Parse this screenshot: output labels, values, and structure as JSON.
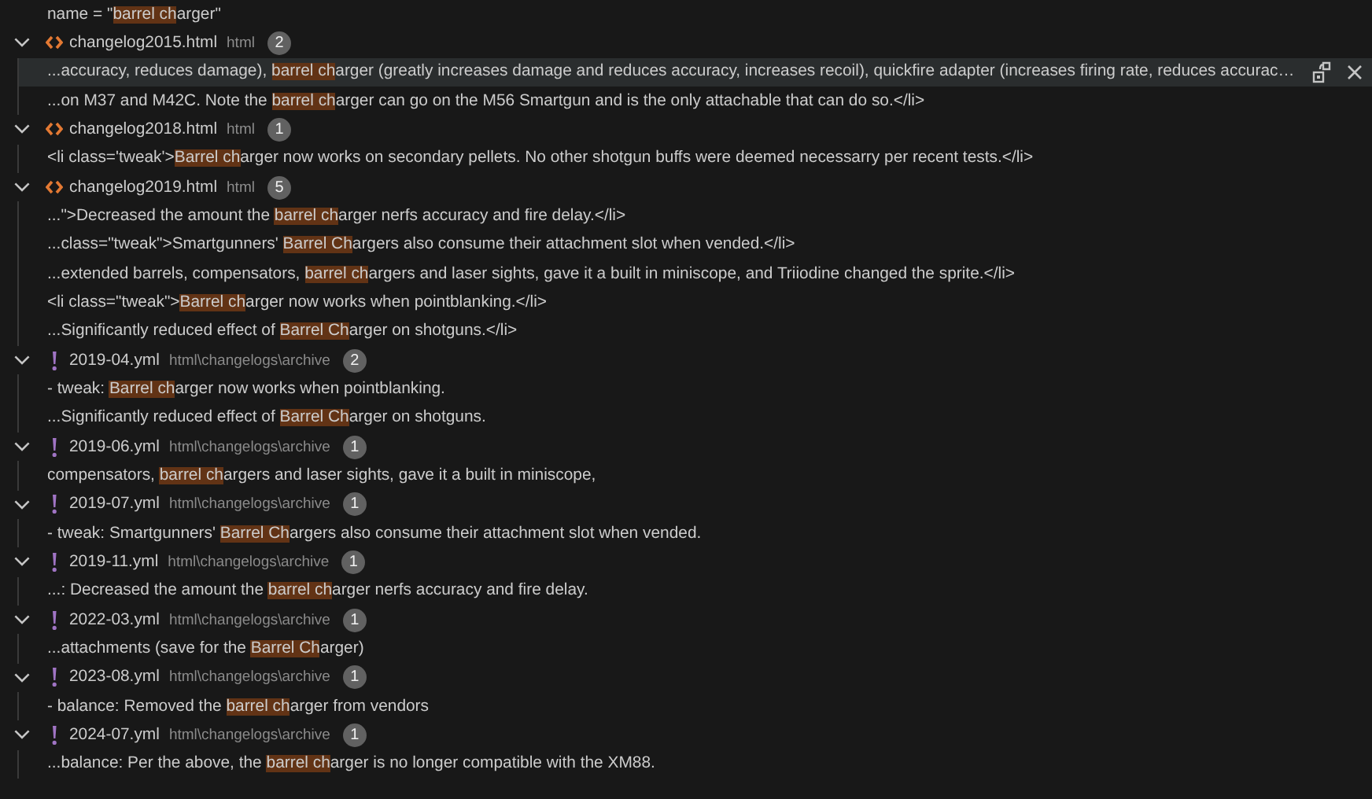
{
  "top_line": {
    "before": "name = \"",
    "match": "barrel ch",
    "after": "arger\""
  },
  "files": [
    {
      "name": "changelog2015.html",
      "kind": "markup",
      "detail": "html",
      "count": "2",
      "expanded": true,
      "matches": [
        {
          "before": "...accuracy, reduces damage), ",
          "match": "barrel ch",
          "after": "arger (greatly increases damage and reduces accuracy, increases recoil), quickfire adapter (increases firing rate, reduces accurac…",
          "selected": true
        },
        {
          "before": "...on M37 and M42C. Note the ",
          "match": "barrel ch",
          "after": "arger can go on the M56 Smartgun and is the only attachable that can do so.</li>",
          "selected": false
        }
      ]
    },
    {
      "name": "changelog2018.html",
      "kind": "markup",
      "detail": "html",
      "count": "1",
      "expanded": true,
      "matches": [
        {
          "before": "<li class='tweak'>",
          "match": "Barrel ch",
          "after": "arger now works on secondary pellets. No other shotgun buffs were deemed necessarry per recent tests.</li>",
          "selected": false
        }
      ]
    },
    {
      "name": "changelog2019.html",
      "kind": "markup",
      "detail": "html",
      "count": "5",
      "expanded": true,
      "matches": [
        {
          "before": "...\">Decreased the amount the ",
          "match": "barrel ch",
          "after": "arger nerfs accuracy and fire delay.</li>",
          "selected": false
        },
        {
          "before": "...class=\"tweak\">Smartgunners' ",
          "match": "Barrel Ch",
          "after": "argers also consume their attachment slot when vended.</li>",
          "selected": false
        },
        {
          "before": "...extended barrels, compensators, ",
          "match": "barrel ch",
          "after": "argers and laser sights, gave it a built in miniscope, and Triiodine changed the sprite.</li>",
          "selected": false
        },
        {
          "before": "<li class=\"tweak\">",
          "match": "Barrel ch",
          "after": "arger now works when pointblanking.</li>",
          "selected": false
        },
        {
          "before": "...Significantly reduced effect of ",
          "match": "Barrel Ch",
          "after": "arger on shotguns.</li>",
          "selected": false
        }
      ]
    },
    {
      "name": "2019-04.yml",
      "kind": "yaml",
      "detail": "html\\changelogs\\archive",
      "count": "2",
      "expanded": true,
      "matches": [
        {
          "before": "- tweak: ",
          "match": "Barrel ch",
          "after": "arger now works when pointblanking.",
          "selected": false
        },
        {
          "before": "...Significantly reduced effect of ",
          "match": "Barrel Ch",
          "after": "arger on shotguns.",
          "selected": false
        }
      ]
    },
    {
      "name": "2019-06.yml",
      "kind": "yaml",
      "detail": "html\\changelogs\\archive",
      "count": "1",
      "expanded": true,
      "matches": [
        {
          "before": "compensators, ",
          "match": "barrel ch",
          "after": "argers and laser sights, gave it a built in miniscope,",
          "selected": false
        }
      ]
    },
    {
      "name": "2019-07.yml",
      "kind": "yaml",
      "detail": "html\\changelogs\\archive",
      "count": "1",
      "expanded": true,
      "matches": [
        {
          "before": "- tweak: Smartgunners' ",
          "match": "Barrel Ch",
          "after": "argers also consume their attachment slot when vended.",
          "selected": false
        }
      ]
    },
    {
      "name": "2019-11.yml",
      "kind": "yaml",
      "detail": "html\\changelogs\\archive",
      "count": "1",
      "expanded": true,
      "matches": [
        {
          "before": "...: Decreased the amount the ",
          "match": "barrel ch",
          "after": "arger nerfs accuracy and fire delay.",
          "selected": false
        }
      ]
    },
    {
      "name": "2022-03.yml",
      "kind": "yaml",
      "detail": "html\\changelogs\\archive",
      "count": "1",
      "expanded": true,
      "matches": [
        {
          "before": "...attachments (save for the ",
          "match": "Barrel Ch",
          "after": "arger)",
          "selected": false
        }
      ]
    },
    {
      "name": "2023-08.yml",
      "kind": "yaml",
      "detail": "html\\changelogs\\archive",
      "count": "1",
      "expanded": true,
      "matches": [
        {
          "before": "- balance: Removed the ",
          "match": "barrel ch",
          "after": "arger from vendors",
          "selected": false
        }
      ]
    },
    {
      "name": "2024-07.yml",
      "kind": "yaml",
      "detail": "html\\changelogs\\archive",
      "count": "1",
      "expanded": true,
      "matches": [
        {
          "before": "...balance: Per the above, the ",
          "match": "barrel ch",
          "after": "arger is no longer compatible with the XM88.",
          "selected": false
        }
      ]
    }
  ]
}
